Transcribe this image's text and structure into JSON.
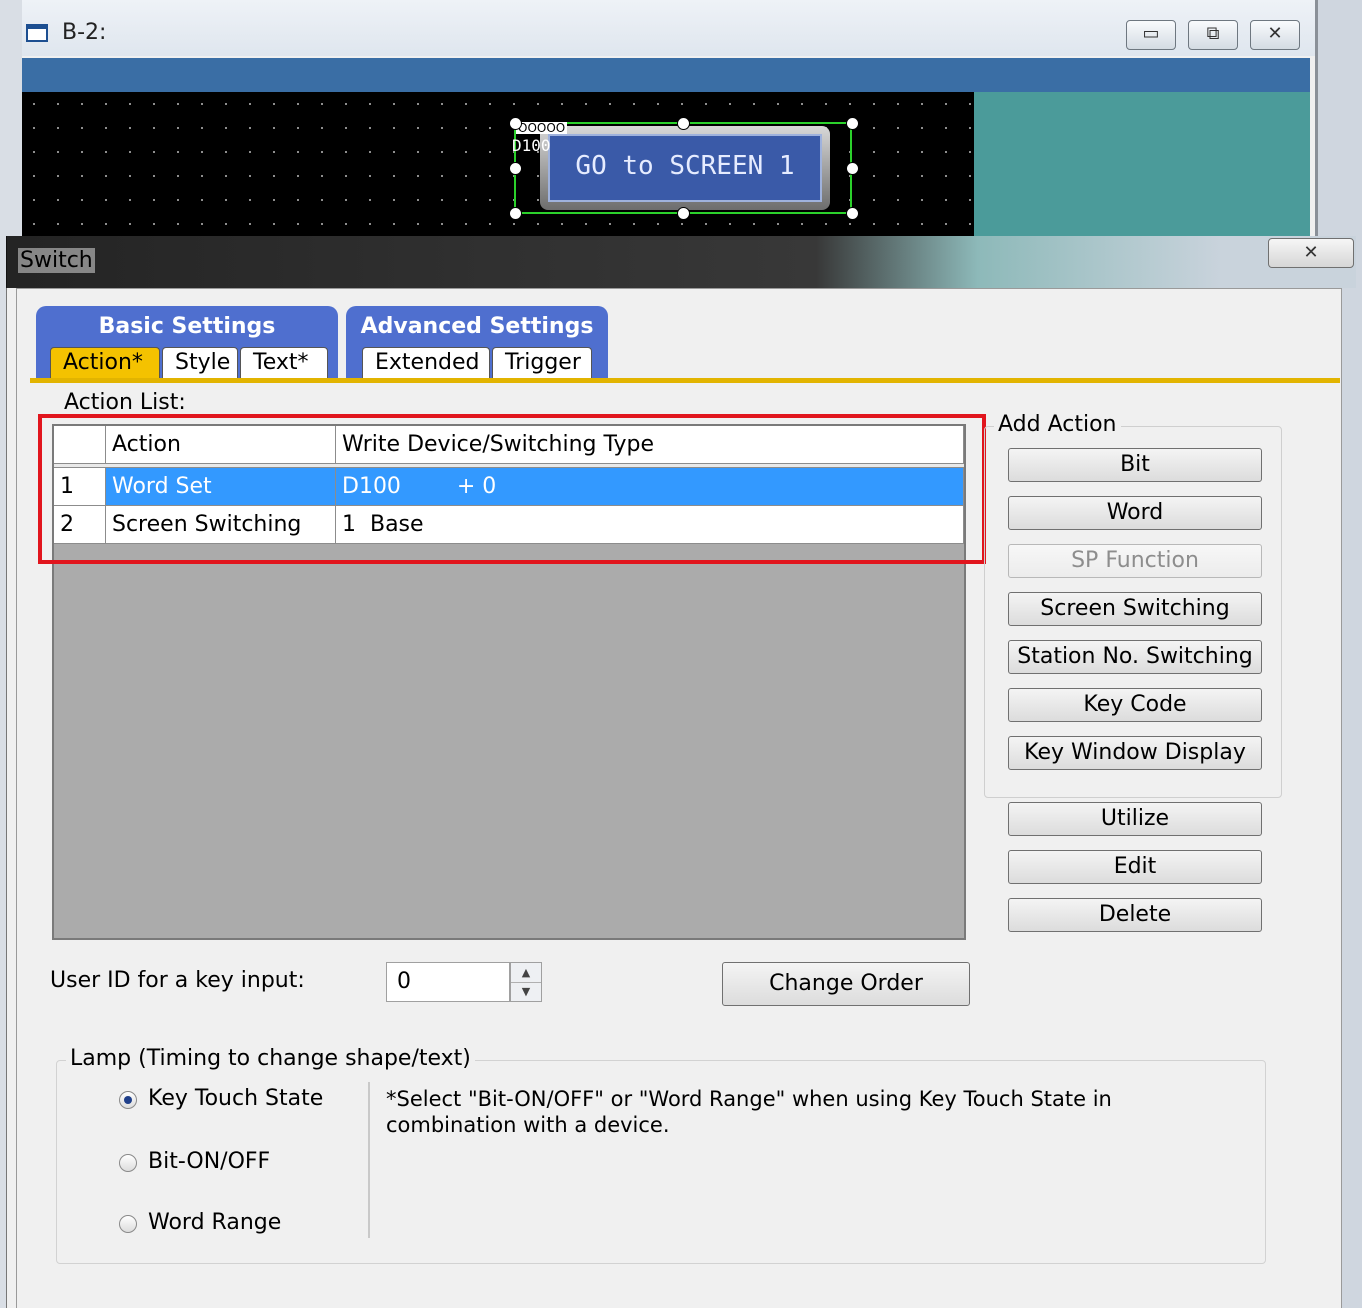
{
  "background_window": {
    "title": "B-2:",
    "caption_buttons": [
      "▭",
      "⧉",
      "✕"
    ],
    "canvas": {
      "button_text": "GO to SCREEN 1",
      "device_label": "D100",
      "lamp_marker": "OOOOO"
    }
  },
  "dialog": {
    "title": "Switch",
    "close_glyph": "✕",
    "tab_groups": [
      {
        "title": "Basic Settings",
        "tabs": [
          "Action*",
          "Style",
          "Text*"
        ]
      },
      {
        "title": "Advanced Settings",
        "tabs": [
          "Extended",
          "Trigger"
        ]
      }
    ],
    "active_tab": "Action*",
    "action_list": {
      "label": "Action List:",
      "columns": [
        "",
        "Action",
        "Write Device/Switching Type"
      ],
      "rows": [
        {
          "no": "1",
          "action": "Word Set",
          "target": "D100        + 0",
          "selected": true
        },
        {
          "no": "2",
          "action": "Screen Switching",
          "target": "1  Base",
          "selected": false
        }
      ]
    },
    "add_action": {
      "label": "Add Action",
      "buttons": [
        {
          "label": "Bit",
          "enabled": true
        },
        {
          "label": "Word",
          "enabled": true
        },
        {
          "label": "SP Function",
          "enabled": false
        },
        {
          "label": "Screen Switching",
          "enabled": true
        },
        {
          "label": "Station No. Switching",
          "enabled": true
        },
        {
          "label": "Key Code",
          "enabled": true
        },
        {
          "label": "Key Window Display",
          "enabled": true
        }
      ]
    },
    "side_buttons": [
      "Utilize",
      "Edit",
      "Delete"
    ],
    "user_id": {
      "label": "User ID for a key input:",
      "value": "0"
    },
    "change_order": "Change Order",
    "lamp": {
      "label": "Lamp (Timing to change shape/text)",
      "options": [
        {
          "label": "Key Touch State",
          "selected": true
        },
        {
          "label": "Bit-ON/OFF",
          "selected": false
        },
        {
          "label": "Word Range",
          "selected": false
        }
      ],
      "note": "*Select \"Bit-ON/OFF\" or \"Word Range\" when using Key Touch State in combination with a device."
    }
  },
  "colors": {
    "tab_group_blue": "#4f6fcf",
    "active_tab_gold": "#f4c200",
    "selection_blue": "#3399ff",
    "highlight_red": "#e1151d"
  }
}
